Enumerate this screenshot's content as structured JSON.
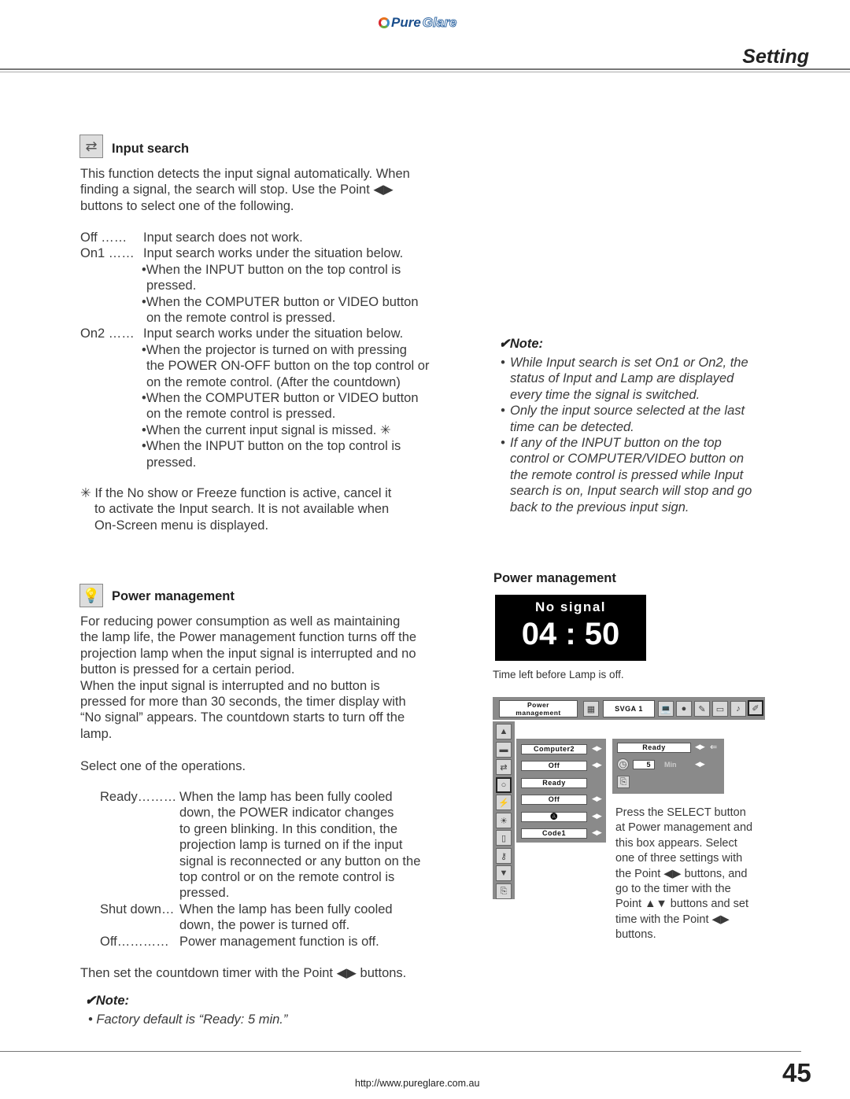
{
  "header": {
    "logo_pure": "Pure",
    "logo_glare": "Glare",
    "section": "Setting"
  },
  "input_search": {
    "icon": "input-search-icon",
    "title": "Input search",
    "intro": [
      "This function detects the input signal automatically. When",
      "finding a signal, the search will stop.  Use the Point ◀▶",
      "buttons to select one of the following."
    ],
    "options": [
      {
        "term": "Off  ……",
        "desc": "Input search does not work.",
        "bullets": []
      },
      {
        "term": "On1 ……",
        "desc": "Input search works under the situation below.",
        "bullets": [
          [
            "•When the INPUT button on the top control is",
            "pressed."
          ],
          [
            "•When the COMPUTER button or VIDEO button",
            "on the remote control is pressed."
          ]
        ]
      },
      {
        "term": "On2 ……",
        "desc": "Input search works under the situation below.",
        "bullets": [
          [
            "•When the projector is turned on with pressing",
            "the POWER ON-OFF button on the top control or",
            "on the remote control. (After the countdown)"
          ],
          [
            "•When the COMPUTER button or VIDEO button",
            "on the remote control is pressed."
          ],
          [
            "•When the current input signal is missed. ✳"
          ],
          [
            "•When the INPUT button on the top control is",
            "pressed."
          ]
        ]
      }
    ],
    "footnote": [
      "✳ If the No show or Freeze function is active, cancel it",
      "to activate the Input search.  It is not available when",
      "On-Screen menu is displayed."
    ]
  },
  "input_search_note": {
    "title": "✔Note:",
    "items": [
      [
        "While Input search is set On1 or On2, the",
        "status of Input and Lamp are displayed",
        "every time the signal is switched."
      ],
      [
        "Only the input source selected at the last",
        "time can be detected."
      ],
      [
        "If any of the INPUT button on the top",
        "control or COMPUTER/VIDEO button on",
        "the remote control is pressed while Input",
        "search is on, Input search will stop and go",
        "back to the previous input sign."
      ]
    ]
  },
  "power_management": {
    "icon": "lamp-icon",
    "title": "Power management",
    "intro": [
      "For reducing power consumption as well as maintaining",
      "the lamp life, the Power management function turns off the",
      "projection lamp when the input signal is interrupted and no",
      "button is pressed for a certain period.",
      "When the input signal is interrupted and no button is",
      "pressed for more than 30 seconds, the timer display with",
      "“No signal” appears. The countdown starts to turn off the",
      "lamp."
    ],
    "select_line": "Select one of the operations.",
    "operations": [
      {
        "term": "Ready………",
        "lines": [
          "When the lamp has been fully cooled",
          "down, the POWER indicator changes",
          "to green blinking. In this condition, the",
          "projection lamp is turned on if the input",
          "signal is reconnected or any button on the",
          "top control or on the remote control is",
          "pressed."
        ]
      },
      {
        "term": "Shut down…",
        "lines": [
          "When the lamp has been fully cooled",
          "down, the power is turned off."
        ]
      },
      {
        "term": "Off…………",
        "lines": [
          "Power management function is off."
        ]
      }
    ],
    "timer_line": "Then set the countdown timer with the Point ◀▶ buttons.",
    "note_title": "✔Note:",
    "note_item": "• Factory default is “Ready: 5 min.”"
  },
  "figure": {
    "title": "Power management",
    "no_signal": "No signal",
    "countdown": "04 : 50",
    "caption": "Time left before Lamp is off."
  },
  "osd": {
    "menu_label": [
      "Power",
      "management"
    ],
    "source": "SVGA 1",
    "list_values": [
      "Computer2",
      "Off",
      "Ready",
      "Off",
      "🅐",
      "Code1"
    ],
    "sub_mode": "Ready",
    "sub_timer_value": "5",
    "sub_timer_unit": "Min",
    "description": [
      "Press the SELECT button",
      "at Power management and",
      "this box appears.  Select",
      "one of three settings with",
      "the Point ◀▶ buttons, and",
      "go to the timer with the",
      "Point ▲▼ buttons and set",
      "time with the Point ◀▶",
      "buttons."
    ]
  },
  "footer": {
    "url": "http://www.pureglare.com.au",
    "page_number": "45"
  }
}
